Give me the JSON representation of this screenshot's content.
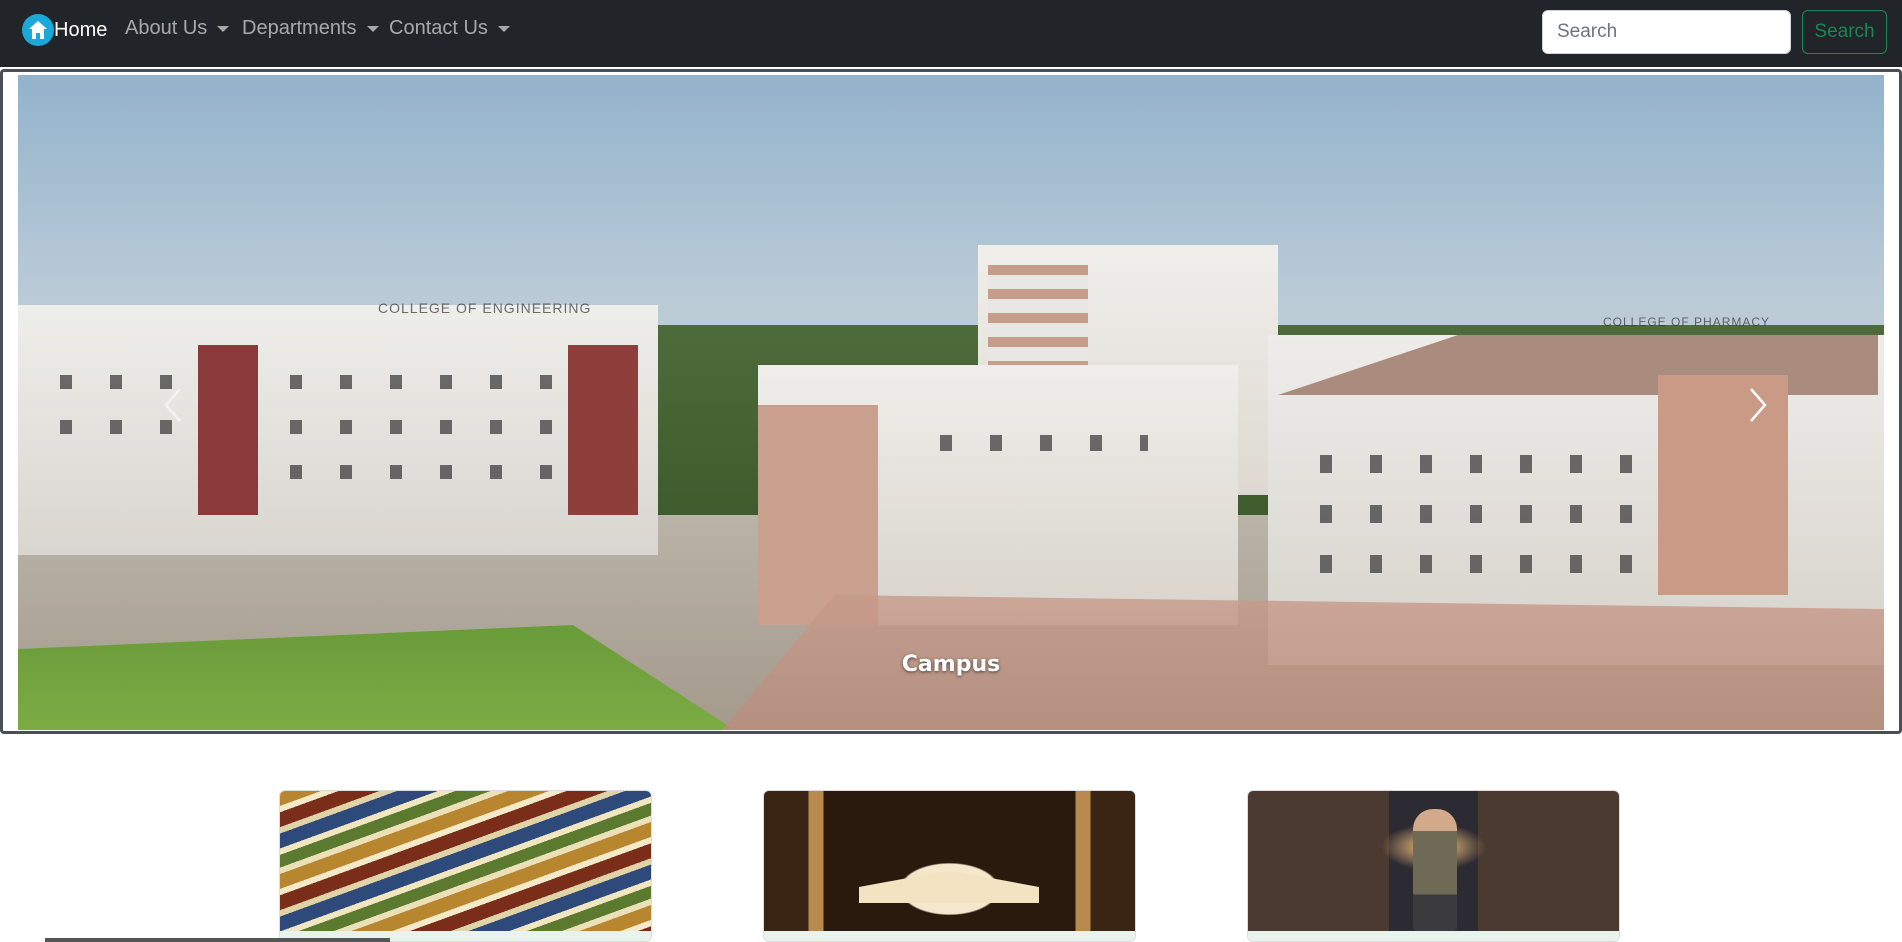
{
  "navbar": {
    "brand_text": "Home",
    "items": [
      {
        "label": "About Us"
      },
      {
        "label": "Departments"
      },
      {
        "label": "Contact Us"
      }
    ],
    "search": {
      "placeholder": "Search",
      "button_label": "Search"
    }
  },
  "carousel": {
    "caption": "Campus",
    "signs": {
      "left": "COLLEGE OF ENGINEERING",
      "right": "COLLEGE OF PHARMACY"
    }
  },
  "cards": [
    {
      "image": "stacked-books-image"
    },
    {
      "image": "open-book-image"
    },
    {
      "image": "library-reader-image"
    }
  ],
  "colors": {
    "navbar_bg": "#212529",
    "brand_icon": "#1ba7d8",
    "search_button": "#198754"
  }
}
